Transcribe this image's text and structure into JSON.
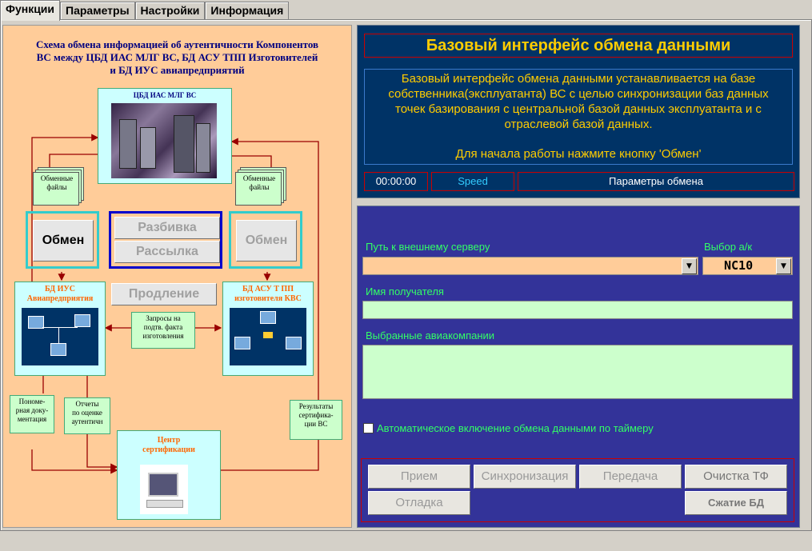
{
  "tabs": [
    "Функции",
    "Параметры",
    "Настройки",
    "Информация"
  ],
  "diagram": {
    "title_lines": [
      "Схема обмена информацией об аутентичности Компонентов",
      "ВС между ЦБД ИАС МЛГ ВС, БД АСУ ТПП Изготовителей",
      "и БД ИУС авиапредприятий"
    ],
    "central_db": "ЦБД ИАС МЛГ ВС",
    "files_left": [
      "Обменные",
      "файлы"
    ],
    "files_right": [
      "Обменные",
      "файлы"
    ],
    "btn_exchange_left": "Обмен",
    "btn_split": "Разбивка",
    "btn_mailing": "Рассылка",
    "btn_exchange_right": "Обмен",
    "btn_extend": "Продление",
    "airline_db": [
      "БД ИУС",
      "Авиапредприятия"
    ],
    "maker_db": [
      "БД АСУ Т ПП",
      "изготовителя КВС"
    ],
    "requests": [
      "Запросы на",
      "подтв. факта",
      "изготовления"
    ],
    "docs": [
      "Пономе-",
      "рная доку-",
      "ментация"
    ],
    "reports": [
      "Отчеты",
      "по оценке",
      "аутентичн"
    ],
    "results": [
      "Результаты",
      "сертифика-",
      "ции ВС"
    ],
    "cert_center": [
      "Центр",
      "сертификации"
    ]
  },
  "info": {
    "title": "Базовый интерфейс обмена данными",
    "desc_lines": [
      "Базовый интерфейс обмена данными устанавливается на базе",
      "собственника(эксплуатанта) ВС с целью синхронизации баз данных",
      "точек базирования с центральной базой данных эксплуатанта и с",
      "отраслевой базой данных."
    ],
    "hint": "Для начала работы нажмите кнопку 'Обмен'",
    "timer": "00:00:00",
    "speed": "Speed",
    "params": "Параметры обмена"
  },
  "form": {
    "server_label": "Путь к внешнему серверу",
    "server_value": "",
    "aircraft_label": "Выбор а/к",
    "aircraft_value": "NC10",
    "recipient_label": "Имя получателя",
    "recipient_value": "",
    "airlines_label": "Выбранные авиакомпании",
    "auto_label": "Автоматическое включение обмена данными по таймеру",
    "auto_checked": false
  },
  "buttons": {
    "receive": "Прием",
    "sync": "Синхронизация",
    "send": "Передача",
    "clear": "Очистка ТФ",
    "debug": "Отладка",
    "compress": "Сжатие БД"
  },
  "colors": {
    "diagram_bg": "#ffcc99",
    "info_bg": "#003366",
    "form_bg": "#333399",
    "accent_yellow": "#ffcc00",
    "label_green": "#33ff66"
  }
}
